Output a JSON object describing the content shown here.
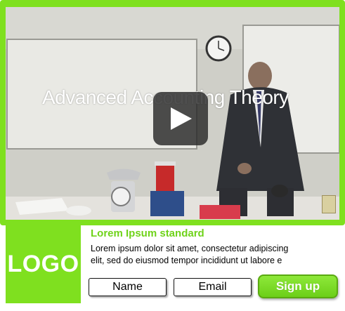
{
  "video": {
    "title": "Advanced Accounting Theory"
  },
  "promo": {
    "logo_text": "LOGO",
    "title": "Lorem Ipsum standard",
    "body": "Lorem ipsum dolor sit amet, consectetur adipiscing elit, sed do eiusmod tempor incididunt ut labore e"
  },
  "form": {
    "name_placeholder": "Name",
    "email_placeholder": "Email",
    "signup_label": "Sign up"
  },
  "colors": {
    "accent": "#7fe01f",
    "accent_text": "#6fd31a"
  }
}
